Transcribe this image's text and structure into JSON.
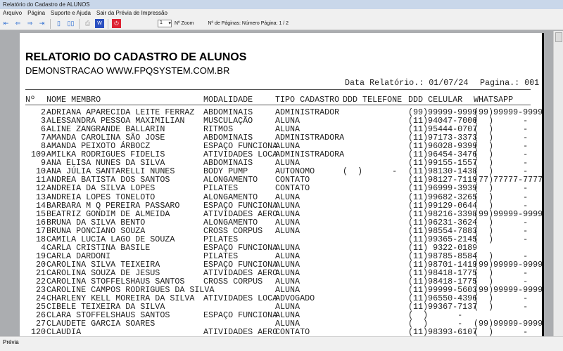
{
  "window": {
    "title": "Relatório do Cadastro de ALUNOS"
  },
  "menu": [
    "Arquivo",
    "Página",
    "Suporte e Ajuda",
    "Sair da Prévia de Impressão"
  ],
  "toolbar": {
    "zoom_value": "1",
    "zoom_label": "Nº Zoom",
    "pages_label": "Nº de Páginas: Número Página: 1 / 2"
  },
  "report": {
    "title": "RELATORIO DO CADASTRO DE ALUNOS",
    "subtitle": "DEMONSTRACAO WWW.FPQSYSTEM.COM.BR",
    "date_label": "Data Relatório.: 01/07/24",
    "page_label": "Pagina.: 001",
    "columns": [
      "Nº",
      "NOME MEMBRO",
      "MODALIDADE",
      "TIPO CADASTRO",
      "DDD TELEFONE",
      "DDD CELULAR",
      "WHATSAPP"
    ],
    "rows": [
      [
        "2",
        "ADRIANA APARECIDA LEITE FERRAZ",
        "ABDOMINAIS",
        "ADMINISTRADOR",
        "",
        "(99)99999-9999",
        "(99)99999-9999"
      ],
      [
        "3",
        "ALESSANDRA PESSOA MAXIMILIAN",
        "MUSCULAÇÃO",
        "ALUNA",
        "",
        "(11)94047-7000",
        "(  )      -"
      ],
      [
        "6",
        "ALINE ZANGRANDE BALLARIN",
        "RITMOS",
        "ALUNA",
        "",
        "(11)95444-0707",
        "(  )      -"
      ],
      [
        "7",
        "AMANDA CAROLINA SÃO JOSE",
        "ABDOMINAIS",
        "ADMINISTRADORA",
        "",
        "(11)97173-3373",
        "(  )      -"
      ],
      [
        "8",
        "AMANDA PEIXOTO ÁRBOCZ",
        "ESPAÇO FUNCIONA",
        "ALUNA",
        "",
        "(11)96028-9399",
        "(  )      -"
      ],
      [
        "109",
        "AMILKA RODRIGUES FIDELIS",
        "ATIVIDADES LOCA",
        "ADMINISTRADORA",
        "",
        "(11)96454-3476",
        "(  )      -"
      ],
      [
        "9",
        "ANA ELISA NUNES DA SILVA",
        "ABDOMINAIS",
        "ALUNA",
        "",
        "(11)99155-1557",
        "(  )      -"
      ],
      [
        "10",
        "ANA JÚLIA SANTARELLI NUNES",
        "BODY PUMP",
        "AUTONOMO",
        "(  )      -",
        "(11)98130-1438",
        "(  )      -"
      ],
      [
        "11",
        "ANDREA BATISTA DOS SANTOS",
        "ALONGAMENTO",
        "CONTATO",
        "",
        "(11)98127-7119",
        "(77)77777-7777"
      ],
      [
        "12",
        "ANDREIA DA SILVA LOPES",
        "PILATES",
        "CONTATO",
        "",
        "(11)96999-3939",
        "(  )      -"
      ],
      [
        "13",
        "ANDREIA LOPES TONELOTO",
        "ALONGAMENTO",
        "ALUNA",
        "",
        "(11)99682-3265",
        "(  )      -"
      ],
      [
        "14",
        "BARBARA M Q PEREIRA PASSARO",
        "ESPAÇO FUNCIONA",
        "ALUNA",
        "",
        "(11)99129-0644",
        "(  )      -"
      ],
      [
        "15",
        "BEATRIZ GONDIM DE ALMEIDA",
        "ATIVIDADES AERO",
        "ALUNA",
        "",
        "(11)98216-3398",
        "(99)99999-9999"
      ],
      [
        "16",
        "BRUNA DA SILVA BENTO",
        "ALONGAMENTO",
        "ALUNA",
        "",
        "(11)96231-3624",
        "(  )      -"
      ],
      [
        "17",
        "BRUNA PONCIANO SOUZA",
        "CROSS CORPUS",
        "ALUNA",
        "",
        "(11)98554-7883",
        "(  )      -"
      ],
      [
        "18",
        "CAMILA LUCIA LAGO DE SOUZA",
        "PILATES",
        "",
        "",
        "(11)99365-2145",
        "(  )      -"
      ],
      [
        "4",
        "CARLA CRISTINA BASILE",
        "ESPAÇO FUNCIONA",
        "ALUNA",
        "",
        "(11) 9322-0189",
        ""
      ],
      [
        "19",
        "CARLA DARDONI",
        "PILATES",
        "ALUNA",
        "",
        "(11)98785-8584",
        "(  )      -"
      ],
      [
        "20",
        "CAROLINA SILVA TEIXEIRA",
        "ESPAÇO FUNCIONA",
        "ALUNA",
        "",
        "(11)98701-1419",
        "(99)99999-9999"
      ],
      [
        "21",
        "CAROLINA SOUZA DE JESUS",
        "ATIVIDADES AERO",
        "ALUNA",
        "",
        "(11)98418-1775",
        "(  )      -"
      ],
      [
        "22",
        "CAROLINA STOFFELSHAUS SANTOS",
        "CROSS CORPUS",
        "ALUNA",
        "",
        "(11)98418-1775",
        "(  )      -"
      ],
      [
        "23",
        "CAROLINE CAMPOS RODRIGUES DA SILVA",
        "",
        "ALUNA",
        "",
        "(11)99999-5603",
        "(99)99999-9999"
      ],
      [
        "24",
        "CHARLENY KELL MOREIRA DA SILVA",
        "ATIVIDADES LOCA",
        "ADVOGADO",
        "",
        "(11)96550-4396",
        "(  )      -"
      ],
      [
        "25",
        "CIBELE TEIXEIRA DA SILVA",
        "",
        "ALUNA",
        "",
        "(11)99367-7137",
        "(  )      -"
      ],
      [
        "26",
        "CLARA STOFFELSHAUS SANTOS",
        "ESPAÇO FUNCIONA",
        "ALUNA",
        "",
        "(  )      -",
        ""
      ],
      [
        "27",
        "CLAUDETE GARCIA SOARES",
        "",
        "ALUNA",
        "",
        "(  )      -",
        "(99)99999-9999"
      ],
      [
        "120",
        "CLAUDIA",
        "ATIVIDADES AERO",
        "CONTATO",
        "",
        "(11)98393-6107",
        "(  )      -"
      ]
    ]
  },
  "status": {
    "text": "Prévia"
  }
}
